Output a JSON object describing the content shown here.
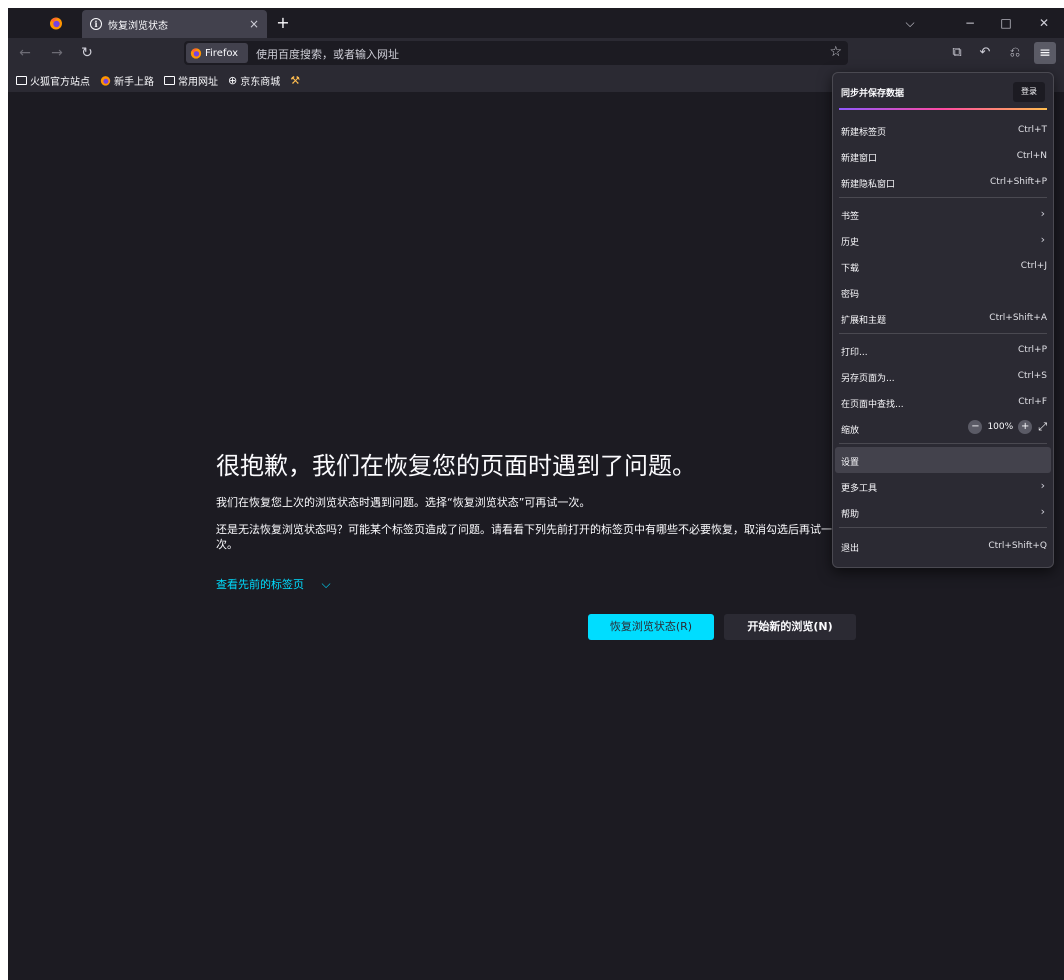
{
  "tab": {
    "title": "恢复浏览状态",
    "info_glyph": "i",
    "close_glyph": "×"
  },
  "tabstrip": {
    "new_tab_glyph": "+",
    "list_glyph": "⌵",
    "min_glyph": "−",
    "max_glyph": "□",
    "close_glyph": "✕"
  },
  "nav": {
    "back_glyph": "←",
    "forward_glyph": "→",
    "reload_glyph": "↻",
    "identity_label": "Firefox",
    "url_placeholder": "使用百度搜索，或者输入网址",
    "star_glyph": "☆",
    "screenshot_glyph": "⧉",
    "undo_glyph": "↶",
    "extensions_glyph": "⎌",
    "menu_glyph": "≡"
  },
  "bookmarks": [
    {
      "label": "火狐官方站点"
    },
    {
      "label": "新手上路"
    },
    {
      "label": "常用网址"
    },
    {
      "label": "京东商城"
    }
  ],
  "content": {
    "title": "很抱歉，我们在恢复您的页面时遇到了问题。",
    "p1": "我们在恢复您上次的浏览状态时遇到问题。选择“恢复浏览状态”可再试一次。",
    "p2": "还是无法恢复浏览状态吗？可能某个标签页造成了问题。请看看下列先前打开的标签页中有哪些不必要恢复，取消勾选后再试一次。",
    "view_tabs": "查看先前的标签页",
    "view_tabs_chev": "⌵",
    "restore_button": "恢复浏览状态(R)",
    "new_session_button": "开始新的浏览(N)"
  },
  "menu": {
    "sync_label": "同步并保存数据",
    "signin_button": "登录",
    "items": [
      {
        "label": "新建标签页",
        "shortcut": "Ctrl+T"
      },
      {
        "label": "新建窗口",
        "shortcut": "Ctrl+N"
      },
      {
        "label": "新建隐私窗口",
        "shortcut": "Ctrl+Shift+P"
      },
      {
        "label": "书签",
        "arrow": "›"
      },
      {
        "label": "历史",
        "arrow": "›"
      },
      {
        "label": "下载",
        "shortcut": "Ctrl+J"
      },
      {
        "label": "密码"
      },
      {
        "label": "扩展和主题",
        "shortcut": "Ctrl+Shift+A"
      },
      {
        "label": "打印...",
        "shortcut": "Ctrl+P"
      },
      {
        "label": "另存页面为...",
        "shortcut": "Ctrl+S"
      },
      {
        "label": "在页面中查找...",
        "shortcut": "Ctrl+F"
      },
      {
        "label": "缩放"
      },
      {
        "label": "设置"
      },
      {
        "label": "更多工具",
        "arrow": "›"
      },
      {
        "label": "帮助",
        "arrow": "›"
      },
      {
        "label": "退出",
        "shortcut": "Ctrl+Shift+Q"
      }
    ],
    "zoom": {
      "minus": "−",
      "value": "100%",
      "plus": "+",
      "fullscreen": "⤢"
    }
  },
  "colors": {
    "accent": "#00ddff",
    "background": "#1c1b22",
    "toolbar": "#2b2a33"
  }
}
